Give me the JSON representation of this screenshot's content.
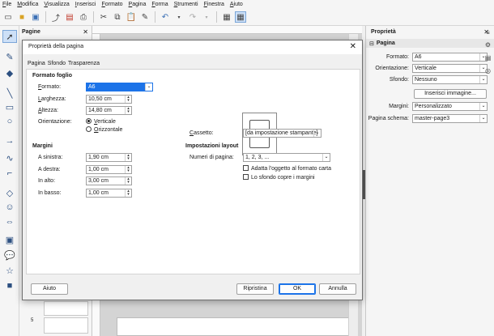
{
  "menubar": [
    "File",
    "Modifica",
    "Visualizza",
    "Inserisci",
    "Formato",
    "Pagina",
    "Forma",
    "Strumenti",
    "Finestra",
    "Aiuto"
  ],
  "pages_pane": {
    "title": "Pagine",
    "visible_page_number": "5"
  },
  "sidebar": {
    "title": "Proprietà",
    "section": "Pagina",
    "formato_label": "Formato:",
    "formato_value": "A6",
    "orientazione_label": "Orientazione:",
    "orientazione_value": "Verticale",
    "sfondo_label": "Sfondo:",
    "sfondo_value": "Nessuno",
    "inserisci_immagine": "Inserisci immagine...",
    "margini_label": "Margini:",
    "margini_value": "Personalizzato",
    "schema_label": "Pagina schema:",
    "schema_value": "master-page3"
  },
  "dialog": {
    "title": "Proprietà della pagina",
    "tabs": [
      "Pagina",
      "Sfondo",
      "Trasparenza"
    ],
    "formato_foglio": {
      "heading": "Formato foglio",
      "formato_label": "Formato:",
      "formato_value": "A6",
      "larghezza_label": "Larghezza:",
      "larghezza_value": "10,50 cm",
      "altezza_label": "Altezza:",
      "altezza_value": "14,80 cm",
      "orientazione_label": "Orientazione:",
      "verticale": "Verticale",
      "orizzontale": "Orizzontale"
    },
    "cassetto_label": "Cassetto:",
    "cassetto_value": "[da impostazione stampante]",
    "margini": {
      "heading": "Margini",
      "sinistra_label": "A sinistra:",
      "sinistra_value": "1,90 cm",
      "destra_label": "A destra:",
      "destra_value": "1,00 cm",
      "alto_label": "In alto:",
      "alto_value": "3,00 cm",
      "basso_label": "In basso:",
      "basso_value": "1,00 cm"
    },
    "layout": {
      "heading": "Impostazioni layout",
      "numeri_label": "Numeri di pagina:",
      "numeri_value": "1, 2, 3, ...",
      "adatta": "Adatta l'oggetto al formato carta",
      "sfondo_copre": "Lo sfondo copre i margini"
    },
    "buttons": {
      "aiuto": "Aiuto",
      "ripristina": "Ripristina",
      "ok": "OK",
      "annulla": "Annulla"
    }
  },
  "colors": {
    "accent": "#1c73e8",
    "selection": "#1c73e8"
  }
}
